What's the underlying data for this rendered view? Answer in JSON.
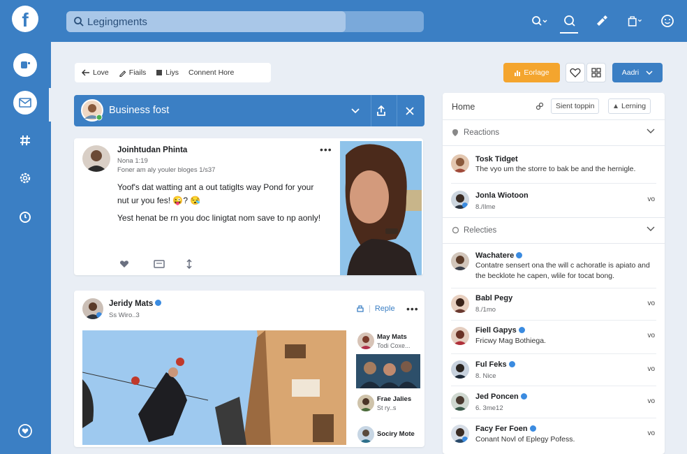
{
  "topbar": {
    "search_value": "Legingments",
    "search_placeholder": "Search"
  },
  "breadcrumb": [
    {
      "label": "Love",
      "icon": "back-arrow-icon"
    },
    {
      "label": "Fiails",
      "icon": "pencil-icon"
    },
    {
      "label": "Liys",
      "icon": "list-icon"
    },
    {
      "label": "Connent Hore",
      "icon": ""
    }
  ],
  "actions": {
    "primary_label": "Eorlage",
    "dropdown_label": "Aadri"
  },
  "composer": {
    "title": "Business fost"
  },
  "post1": {
    "author": "Joinhtudan Phinta",
    "meta1": "Nona 1:19",
    "meta2": "Foner am aly youler bloges 1/s37",
    "line1": "Yoof's dat watting ant a out tatiglts way Pond for your",
    "line2": "nut ur you fes! 😜? 😪",
    "line3": "Yest henat be rn you doc linigtat nom save to np aonly!"
  },
  "post2": {
    "author": "Jeridy Mats",
    "meta": "Ss Wiro..3",
    "reply_label": "Reple",
    "side_people": [
      {
        "name": "May Mats",
        "sub": "Todi Coxe..."
      },
      {
        "name": "Frae Jalies",
        "sub": "St ry..s"
      },
      {
        "name": "Sociry Mote",
        "sub": ""
      }
    ]
  },
  "panel": {
    "title": "Home",
    "pill1": "Sient toppin",
    "pill2": "Lerning",
    "section1": "Reactions",
    "section2": "Relecties",
    "rows_top": [
      {
        "name": "Tosk Tidget",
        "sub": "The vyo um the storre to bak be and the hernigle.",
        "act": ""
      },
      {
        "name": "Jonla Wiotoon",
        "sub": "8./Ilme",
        "act": "vo"
      }
    ],
    "rows_bottom": [
      {
        "name": "Wachatere",
        "sub": "Contatre sensert ona the will c achoratle is apiato and the becklote he capen, wlile for tocat bong.",
        "act": ""
      },
      {
        "name": "Babl Pegy",
        "sub": "8./1mo",
        "act": "vo"
      },
      {
        "name": "Fiell Gapys",
        "sub": "Fricwy Mag Bothiega.",
        "act": "vo"
      },
      {
        "name": "Ful Feks",
        "sub": "8. Nice",
        "act": "vo"
      },
      {
        "name": "Jed Poncen",
        "sub": "6. 3me12",
        "act": "vo"
      },
      {
        "name": "Facy Fer Foen",
        "sub": "Conant Novl of Eplegy Pofess.",
        "act": "vo"
      }
    ]
  },
  "colors": {
    "brand": "#3b7fc4",
    "accent_orange": "#f4a52e",
    "background": "#e9eef5"
  }
}
